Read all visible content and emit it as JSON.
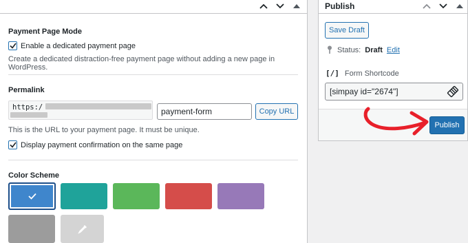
{
  "left_panel": {
    "payment_page_mode": {
      "title": "Payment Page Mode",
      "checkbox_label": "Enable a dedicated payment page",
      "checked": true,
      "description": "Create a dedicated distraction-free payment page without adding a new page in WordPress."
    },
    "permalink": {
      "title": "Permalink",
      "prefix": "https:/",
      "slug_value": "payment-form",
      "copy_label": "Copy URL",
      "help": "This is the URL to your payment page. It must be unique.",
      "confirm_label": "Display payment confirmation on the same page",
      "confirm_checked": true
    },
    "color_scheme": {
      "title": "Color Scheme",
      "swatches": [
        {
          "color": "#3f86cc",
          "selected": true
        },
        {
          "color": "#1fa39a"
        },
        {
          "color": "#5bb75a"
        },
        {
          "color": "#d54d4a"
        },
        {
          "color": "#9779b8"
        },
        {
          "color": "#9c9c9c"
        },
        {
          "color": "#d4d4d4",
          "icon": "eyedropper-icon"
        }
      ]
    }
  },
  "publish_box": {
    "title": "Publish",
    "save_draft": "Save Draft",
    "status_label": "Status:",
    "status_value": "Draft",
    "edit_link": "Edit",
    "shortcode_icon": "[/]",
    "shortcode_label": "Form Shortcode",
    "shortcode_value": "[simpay id=\"2674\"]",
    "publish_label": "Publish",
    "accent_color": "#2271b1",
    "arrow_color": "#e8202a"
  }
}
